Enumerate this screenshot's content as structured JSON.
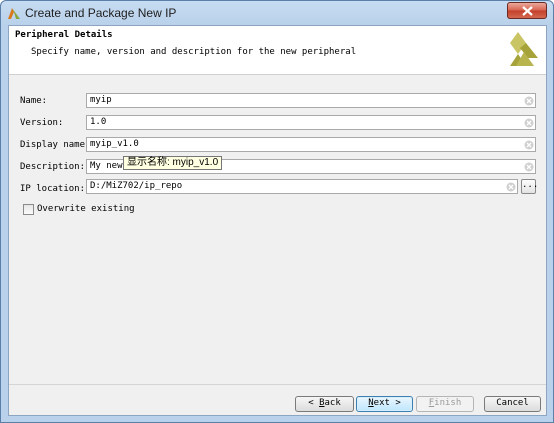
{
  "window": {
    "title": "Create and Package New IP",
    "icon": "vivado-logo-icon",
    "close_icon": "close-icon"
  },
  "header": {
    "title": "Peripheral Details",
    "description": "Specify name, version and description for the new peripheral",
    "logo": "xilinx-logo"
  },
  "form": {
    "name": {
      "label": "Name:",
      "value": "myip"
    },
    "version": {
      "label": "Version:",
      "value": "1.0"
    },
    "display_name": {
      "label": "Display name:",
      "value": "myip_v1.0"
    },
    "description": {
      "label": "Description:",
      "value": "My new"
    },
    "ip_location": {
      "label": "IP location:",
      "value": "D:/MiZ702/ip_repo",
      "browse_label": "..."
    },
    "overwrite": {
      "label": "Overwrite existing",
      "checked": false
    }
  },
  "tooltip": {
    "text": "显示名称: myip_v1.0"
  },
  "buttons": {
    "back": {
      "prefix": "< ",
      "mnemonic": "B",
      "rest": "ack"
    },
    "next": {
      "mnemonic": "N",
      "rest": "ext",
      "suffix": " >"
    },
    "finish": {
      "mnemonic": "F",
      "rest": "inish"
    },
    "cancel": {
      "label": "Cancel"
    }
  },
  "colors": {
    "title_bar": "#b9d1ea",
    "close_button": "#c23f2a",
    "logo_green": "#a6a33a",
    "tooltip_bg": "#ffffe1"
  }
}
